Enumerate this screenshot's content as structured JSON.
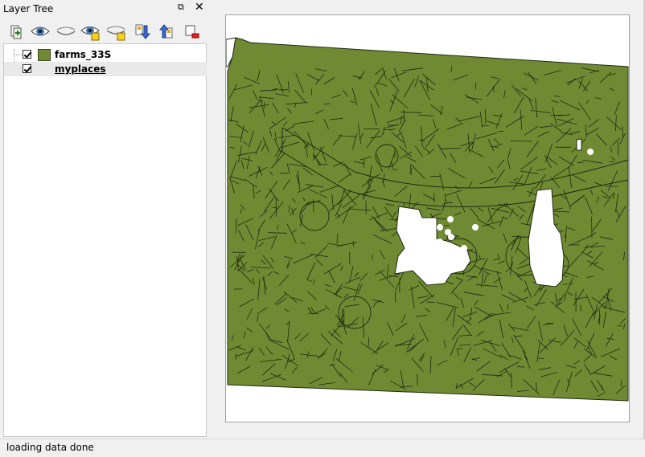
{
  "dock": {
    "title": "Layer Tree",
    "float_glyph": "⧉",
    "close_glyph": "✕"
  },
  "toolbar": {
    "buttons": [
      {
        "name": "add-group-icon"
      },
      {
        "name": "show-all-icon"
      },
      {
        "name": "hide-all-icon"
      },
      {
        "name": "show-selected-icon"
      },
      {
        "name": "hide-selected-icon"
      },
      {
        "name": "move-down-icon"
      },
      {
        "name": "move-up-icon"
      },
      {
        "name": "remove-layer-icon"
      }
    ]
  },
  "layers": [
    {
      "label": "farms_33S",
      "checked": true,
      "swatch": "#6f8a33",
      "underlined": false,
      "selected": false
    },
    {
      "label": "myplaces",
      "checked": true,
      "swatch": null,
      "underlined": true,
      "selected": true
    }
  ],
  "map": {
    "fill_color": "#6f8a33",
    "line_color": "#1e2a10",
    "background": "#ffffff"
  },
  "status": {
    "text": "loading data done"
  }
}
